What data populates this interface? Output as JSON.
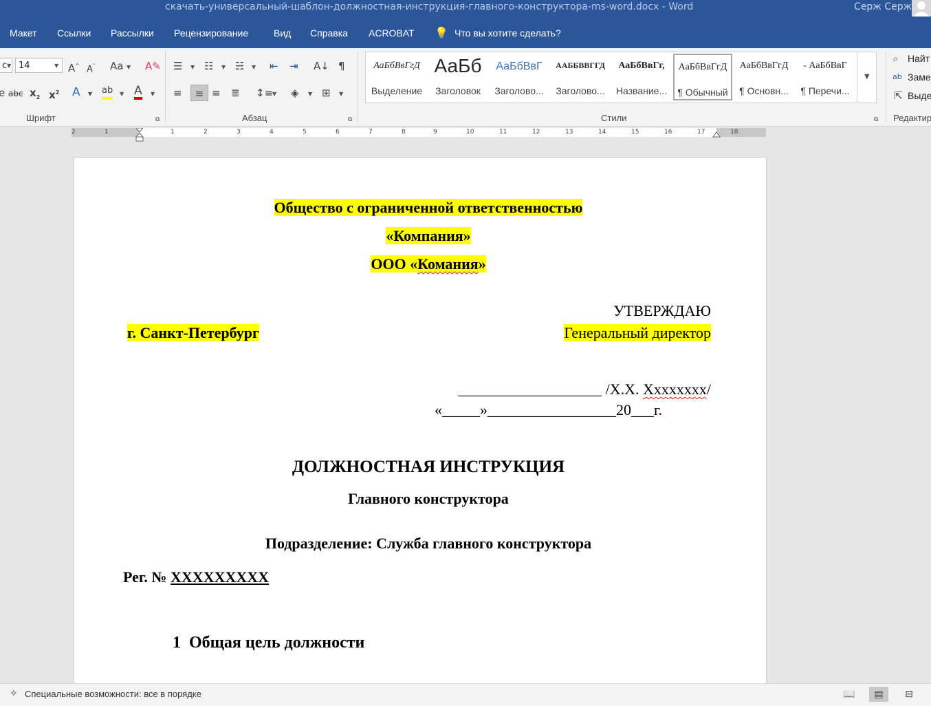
{
  "titlebar": {
    "title": "скачать-универсальный-шаблон-должностная-инструкция-главного-конструктора-ms-word.docx  -  Word",
    "user": "Серж Серж"
  },
  "menu": [
    "Макет",
    "Ссылки",
    "Рассылки",
    "Рецензирование",
    "Вид",
    "Справка",
    "ACROBAT"
  ],
  "tell_me": "Что вы хотите сделать?",
  "font": {
    "name_partial": "с",
    "size": "14",
    "group_label": "Шрифт"
  },
  "paragraph": {
    "group_label": "Абзац"
  },
  "styles": {
    "group_label": "Стили",
    "items": [
      {
        "sample": "АаБбВвГгД",
        "name": "Выделение"
      },
      {
        "sample": "АаБб",
        "name": "Заголовок"
      },
      {
        "sample": "АаБбВвГ",
        "name": "Заголово..."
      },
      {
        "sample": "ААББВВГГД",
        "name": "Заголово..."
      },
      {
        "sample": "АаБбВвГг,",
        "name": "Название..."
      },
      {
        "sample": "АаБбВвГгД",
        "name": "¶ Обычный"
      },
      {
        "sample": "АаБбВвГгД",
        "name": "¶ Основн..."
      },
      {
        "sample": "-  АаБбВвГ",
        "name": "¶ Перечи..."
      }
    ]
  },
  "editing": {
    "find": "Найт",
    "replace": "Заме",
    "select": "Выде",
    "group_label": "Редактир"
  },
  "ruler": {
    "labels": [
      "2",
      "1",
      "1",
      "2",
      "3",
      "4",
      "5",
      "6",
      "7",
      "8",
      "9",
      "10",
      "11",
      "12",
      "13",
      "14",
      "15",
      "16",
      "17",
      "18"
    ]
  },
  "document": {
    "org_line1": "Общество с ограниченной ответственностью",
    "org_line2": "«Компания»",
    "org_line3_prefix": "ООО «",
    "org_line3_word": "Комания",
    "org_line3_suffix": "»",
    "approve": "УТВЕРЖДАЮ",
    "city": "г. Санкт-Петербург",
    "position": "Генеральный директор",
    "signature_line": "___________________ /Х.Х. ",
    "signature_name": "Ххххххxx",
    "signature_end": "/",
    "date_line": "«_____»_________________20___г.",
    "doc_title": "ДОЛЖНОСТНАЯ ИНСТРУКЦИЯ",
    "doc_subtitle": "Главного конструктора",
    "division": "Подразделение: Служба главного конструктора",
    "reg_label": "Рег. № ",
    "reg_value": "XXXXXXXXX",
    "section_num": "1",
    "section_title": "Общая цель должности"
  },
  "status": {
    "accessibility": "Специальные возможности: все в порядке"
  }
}
